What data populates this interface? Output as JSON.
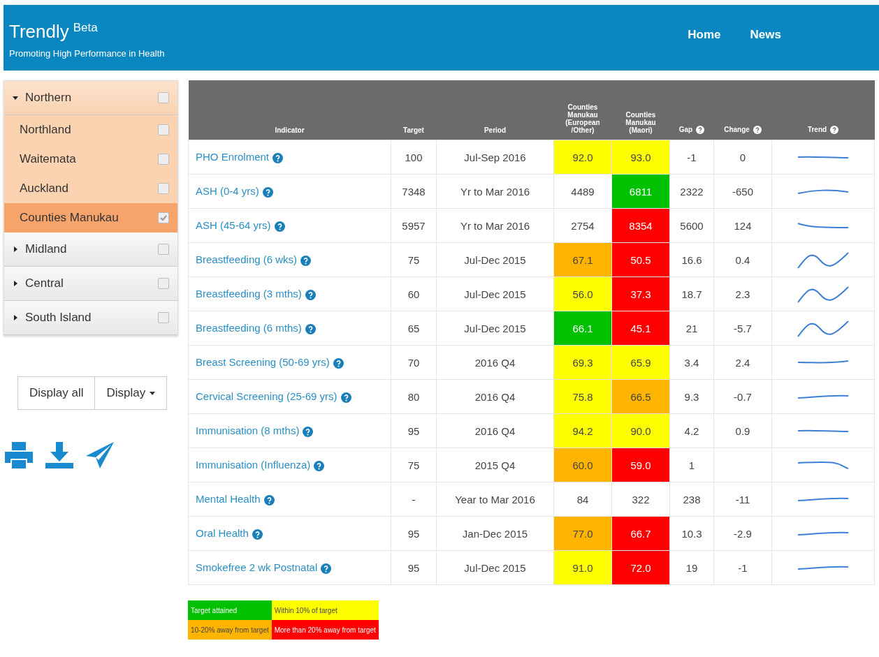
{
  "header": {
    "title": "Trendly",
    "badge": "Beta",
    "tagline": "Promoting High Performance in Health",
    "nav": [
      {
        "label": "Home"
      },
      {
        "label": "News"
      }
    ]
  },
  "sidebar": {
    "regions": [
      {
        "label": "Northern",
        "expanded": true,
        "checked": false,
        "children": [
          {
            "label": "Northland",
            "checked": false,
            "selected": false
          },
          {
            "label": "Waitemata",
            "checked": false,
            "selected": false
          },
          {
            "label": "Auckland",
            "checked": false,
            "selected": false
          },
          {
            "label": "Counties Manukau",
            "checked": true,
            "selected": true
          }
        ]
      },
      {
        "label": "Midland",
        "expanded": false,
        "checked": false
      },
      {
        "label": "Central",
        "expanded": false,
        "checked": false
      },
      {
        "label": "South Island",
        "expanded": false,
        "checked": false
      }
    ],
    "buttons": [
      {
        "label": "Display all",
        "kind": "plain"
      },
      {
        "label": "Display",
        "kind": "dropdown"
      }
    ]
  },
  "table": {
    "columns": [
      {
        "label": "Indicator",
        "help": false
      },
      {
        "label": "Target",
        "help": false
      },
      {
        "label": "Period",
        "help": false
      },
      {
        "label": "Counties Manukau (European /Other)",
        "help": false
      },
      {
        "label": "Counties Manukau (Maori)",
        "help": false
      },
      {
        "label": "Gap",
        "help": true
      },
      {
        "label": "Change",
        "help": true
      },
      {
        "label": "Trend",
        "help": true
      }
    ],
    "rows": [
      {
        "indicator": "PHO Enrolment",
        "target": "100",
        "period": "Jul-Sep 2016",
        "european": {
          "value": "92.0",
          "color": "#ffff00"
        },
        "maori": {
          "value": "93.0",
          "color": "#ffff00"
        },
        "gap": "-1",
        "change": "0"
      },
      {
        "indicator": "ASH (0-4 yrs)",
        "target": "7348",
        "period": "Yr to Mar 2016",
        "european": {
          "value": "4489",
          "color": "#ffffff"
        },
        "maori": {
          "value": "6811",
          "color": "#00c000"
        },
        "gap": "2322",
        "change": "-650"
      },
      {
        "indicator": "ASH (45-64 yrs)",
        "target": "5957",
        "period": "Yr to Mar 2016",
        "european": {
          "value": "2754",
          "color": "#ffffff"
        },
        "maori": {
          "value": "8354",
          "color": "#ff0000"
        },
        "gap": "5600",
        "change": "124"
      },
      {
        "indicator": "Breastfeeding (6 wks)",
        "target": "75",
        "period": "Jul-Dec 2015",
        "european": {
          "value": "67.1",
          "color": "#ffb400"
        },
        "maori": {
          "value": "50.5",
          "color": "#ff0000"
        },
        "gap": "16.6",
        "change": "0.4"
      },
      {
        "indicator": "Breastfeeding (3 mths)",
        "target": "60",
        "period": "Jul-Dec 2015",
        "european": {
          "value": "56.0",
          "color": "#ffff00"
        },
        "maori": {
          "value": "37.3",
          "color": "#ff0000"
        },
        "gap": "18.7",
        "change": "2.3"
      },
      {
        "indicator": "Breastfeeding (6 mths)",
        "target": "65",
        "period": "Jul-Dec 2015",
        "european": {
          "value": "66.1",
          "color": "#00c000"
        },
        "maori": {
          "value": "45.1",
          "color": "#ff0000"
        },
        "gap": "21",
        "change": "-5.7"
      },
      {
        "indicator": "Breast Screening (50-69 yrs)",
        "target": "70",
        "period": "2016 Q4",
        "european": {
          "value": "69.3",
          "color": "#ffff00"
        },
        "maori": {
          "value": "65.9",
          "color": "#ffff00"
        },
        "gap": "3.4",
        "change": "2.4"
      },
      {
        "indicator": "Cervical Screening (25-69 yrs)",
        "target": "80",
        "period": "2016 Q4",
        "european": {
          "value": "75.8",
          "color": "#ffff00"
        },
        "maori": {
          "value": "66.5",
          "color": "#ffb400"
        },
        "gap": "9.3",
        "change": "-0.7"
      },
      {
        "indicator": "Immunisation (8 mths)",
        "target": "95",
        "period": "2016 Q4",
        "european": {
          "value": "94.2",
          "color": "#ffff00"
        },
        "maori": {
          "value": "90.0",
          "color": "#ffff00"
        },
        "gap": "4.2",
        "change": "0.9"
      },
      {
        "indicator": "Immunisation (Influenza)",
        "target": "75",
        "period": "2015 Q4",
        "european": {
          "value": "60.0",
          "color": "#ffb400"
        },
        "maori": {
          "value": "59.0",
          "color": "#ff0000"
        },
        "gap": "1"
      },
      {
        "indicator": "Mental Health",
        "target": "-",
        "period": "Year to Mar 2016",
        "european": {
          "value": "84",
          "color": "#ffffff"
        },
        "maori": {
          "value": "322",
          "color": "#ffffff"
        },
        "gap": "238",
        "change": "-11"
      },
      {
        "indicator": "Oral Health",
        "target": "95",
        "period": "Jan-Dec 2015",
        "european": {
          "value": "77.0",
          "color": "#ffb400"
        },
        "maori": {
          "value": "66.7",
          "color": "#ff0000"
        },
        "gap": "10.3",
        "change": "-2.9"
      },
      {
        "indicator": "Smokefree 2 wk Postnatal",
        "target": "95",
        "period": "Jul-Dec 2015",
        "european": {
          "value": "91.0",
          "color": "#ffff00"
        },
        "maori": {
          "value": "72.0",
          "color": "#ff0000"
        },
        "gap": "19",
        "change": "-1"
      }
    ]
  },
  "legend": [
    {
      "label": "Target attained",
      "color": "#00c000"
    },
    {
      "label": "Within 10% of target",
      "color": "#ffff00"
    },
    {
      "label": "10-20% away from target",
      "color": "#ffb400"
    },
    {
      "label": "More than 20% away from target",
      "color": "#ff0000"
    }
  ]
}
